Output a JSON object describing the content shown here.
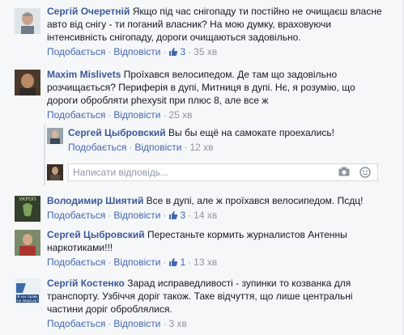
{
  "labels": {
    "like": "Подобається",
    "reply": "Відповісти"
  },
  "reply_box": {
    "placeholder": "Написати відповідь..."
  },
  "comments": [
    {
      "author": "Сергій Очеретній",
      "text": "Якщо під час снігопаду ти постійно не очищаєш власне авто від снігу - ти поганий власник? На мою думку, враховуючи інтенсивність снігопаду, дороги очищаються задовільно.",
      "likes": "3",
      "time": "35 хв"
    },
    {
      "author": "Maxim Mislivets",
      "text": "Проїхався велосипедом. Де там що задовільно розчищається? Периферія в дупі, Митниця в дупі. Нє, я розумію, що дороги обробляти phexysit при плюс 8, але все ж",
      "time": "25 хв",
      "replies": [
        {
          "author": "Сергей Цыбровский",
          "text": "Вы бы ещё на самокате проехались!",
          "time": "12 хв"
        }
      ]
    },
    {
      "author": "Володимир Шиятий",
      "text": "Все в дупі, але ж проїхався велосипедом. Псдц!",
      "likes": "3",
      "time": "14 хв",
      "avatar_text": "УКРОП"
    },
    {
      "author": "Сергей Цыбровский",
      "text": "Перестаньте кормить журналистов Антенны наркотиками!!!",
      "likes": "1",
      "time": "13 хв"
    },
    {
      "author": "Сергій Костенко",
      "text": "Зарад исправедливості - зупинки то козванка для транспорту. Узбіччя доріг також. Таке відчуття, що лише центральні частини доріг оброблялися.",
      "time": "3 хв",
      "avatar_text": "В нас праве на людську!"
    }
  ],
  "colors": {
    "author": "#3b5998",
    "link": "#4267b2",
    "meta": "#90949c",
    "background": "#f6f7f9"
  },
  "icons": {
    "like": "thumbs-up-icon",
    "camera": "camera-icon",
    "emoji": "smiley-icon"
  }
}
